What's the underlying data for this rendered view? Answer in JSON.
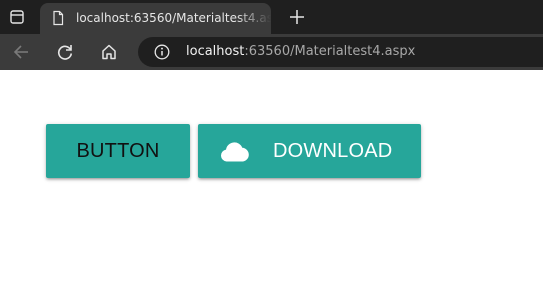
{
  "browser": {
    "tab": {
      "title": "localhost:63560/Materialtest4.aspx",
      "favicon": "page-icon"
    },
    "new_tab_icon": "plus-icon",
    "toolbar": {
      "back_icon": "back-arrow-icon",
      "refresh_icon": "refresh-icon",
      "home_icon": "home-icon",
      "info_icon": "info-icon"
    },
    "address": {
      "host": "localhost",
      "rest": ":63560/Materialtest4.aspx"
    }
  },
  "page": {
    "buttons": [
      {
        "label": "BUTTON"
      },
      {
        "label": "DOWNLOAD",
        "icon": "cloud-icon"
      }
    ]
  },
  "colors": {
    "button_bg": "#26a69a",
    "button_text_dark": "#111111",
    "button_text_light": "#ffffff",
    "tabbar_bg": "#1f1f1f",
    "toolbar_bg": "#3b3b3b"
  }
}
